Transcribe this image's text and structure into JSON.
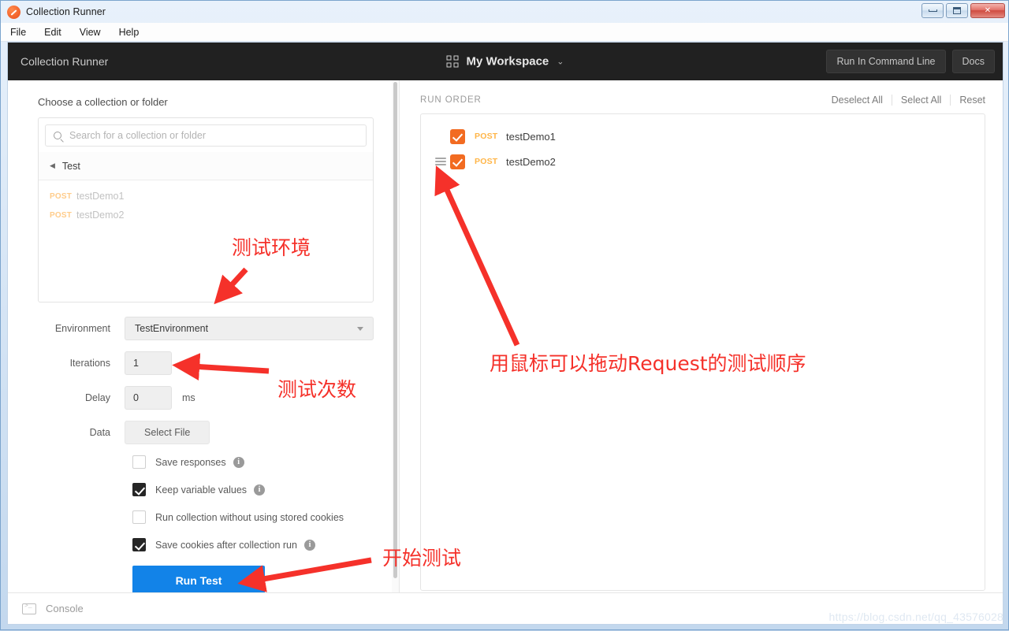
{
  "window": {
    "title": "Collection Runner",
    "logo_icon": "postman-logo-icon",
    "minimize_label": "",
    "maximize_label": "",
    "close_label": "✕",
    "menus": [
      "File",
      "Edit",
      "View",
      "Help"
    ]
  },
  "header": {
    "title": "Collection Runner",
    "workspace_icon": "grid-icon",
    "workspace_name": "My Workspace",
    "workspace_chevron": "⌄",
    "run_cli_label": "Run In Command Line",
    "docs_label": "Docs"
  },
  "left": {
    "section_label": "Choose a collection or folder",
    "search_icon": "search-icon",
    "search_placeholder": "Search for a collection or folder",
    "search_value": "",
    "breadcrumb_arrow": "◀",
    "breadcrumb_label": "Test",
    "requests": [
      {
        "method": "POST",
        "name": "testDemo1"
      },
      {
        "method": "POST",
        "name": "testDemo2"
      }
    ],
    "form": {
      "environment_label": "Environment",
      "environment_value": "TestEnvironment",
      "iterations_label": "Iterations",
      "iterations_value": "1",
      "delay_label": "Delay",
      "delay_value": "0",
      "delay_unit": "ms",
      "data_label": "Data",
      "select_file_label": "Select File"
    },
    "checkboxes": [
      {
        "label": "Save responses",
        "checked": false,
        "info": true
      },
      {
        "label": "Keep variable values",
        "checked": true,
        "info": true
      },
      {
        "label": "Run collection without using stored cookies",
        "checked": false,
        "info": false
      },
      {
        "label": "Save cookies after collection run",
        "checked": true,
        "info": true
      }
    ],
    "run_button_label": "Run Test"
  },
  "right": {
    "run_order_title": "RUN ORDER",
    "actions": [
      "Deselect All",
      "Select All",
      "Reset"
    ],
    "items": [
      {
        "method": "POST",
        "name": "testDemo1",
        "checked": true,
        "draggable": false
      },
      {
        "method": "POST",
        "name": "testDemo2",
        "checked": true,
        "draggable": true
      }
    ]
  },
  "footer": {
    "console_icon": "terminal-icon",
    "console_label": "Console",
    "watermark": "https://blog.csdn.net/qq_43576028"
  },
  "annotations": {
    "environment_note": "测试环境",
    "iterations_note": "测试次数",
    "run_note": "开始测试",
    "order_note": "用鼠标可以拖动Request的测试顺序"
  },
  "colors": {
    "accent_orange": "#f26b21",
    "primary_blue": "#1283e8",
    "header_dark": "#212121",
    "annotation_red": "#f5312a"
  }
}
